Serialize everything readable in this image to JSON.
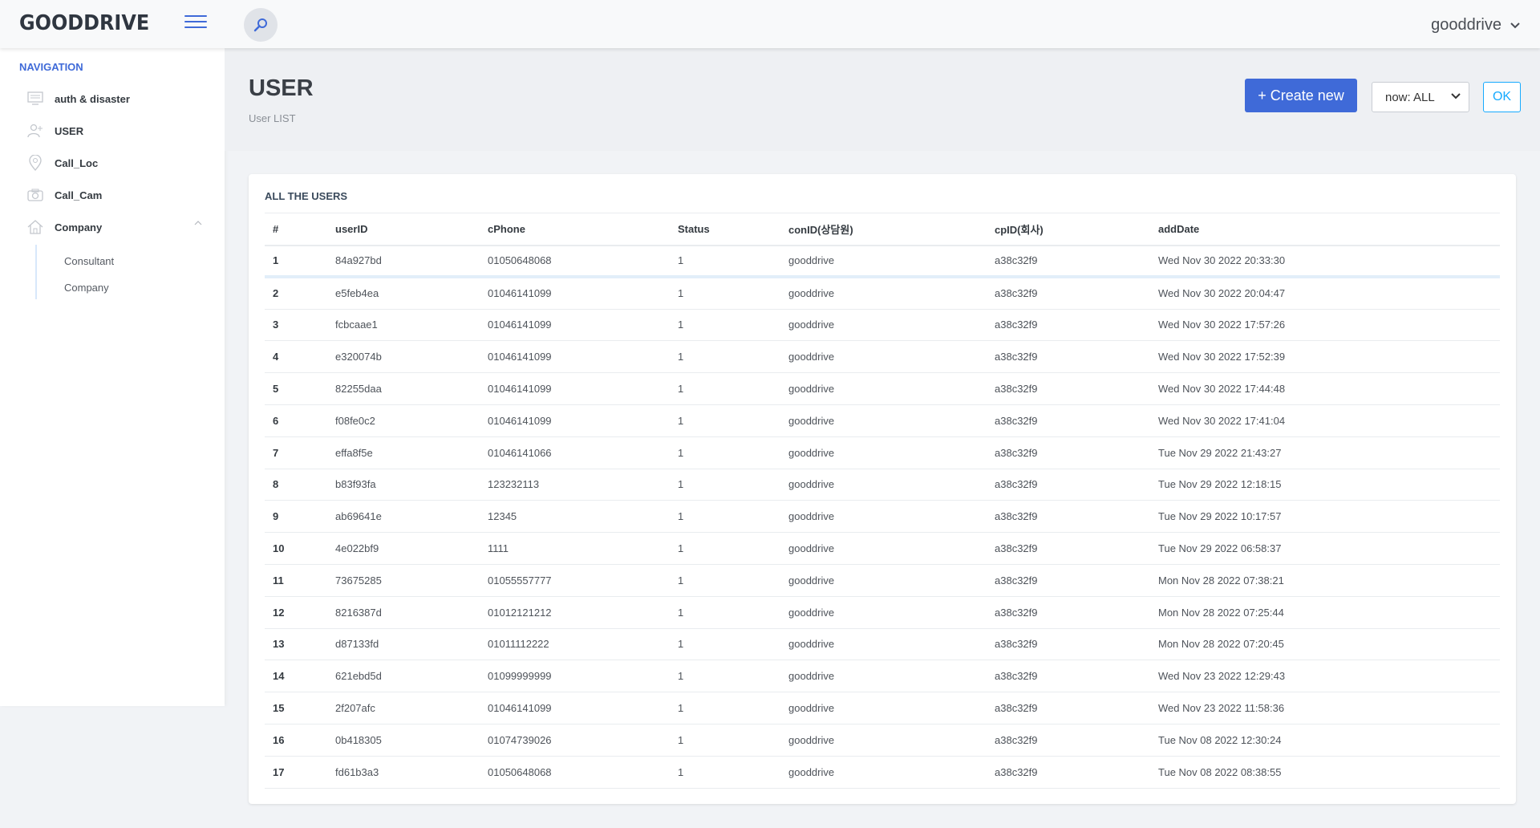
{
  "app": {
    "logo": "GOODDRIVE"
  },
  "header": {
    "user_name": "gooddrive"
  },
  "sidebar": {
    "heading": "NAVIGATION",
    "items": [
      {
        "label": "auth & disaster",
        "icon": "monitor-icon"
      },
      {
        "label": "USER",
        "icon": "user-add-icon"
      },
      {
        "label": "Call_Loc",
        "icon": "map-pin-icon"
      },
      {
        "label": "Call_Cam",
        "icon": "camera-icon"
      },
      {
        "label": "Company",
        "icon": "home-icon"
      }
    ],
    "subitems": [
      {
        "label": "Consultant"
      },
      {
        "label": "Company"
      }
    ]
  },
  "page": {
    "title": "USER",
    "subtitle": "User LIST",
    "create_label": "+ Create new",
    "filter_value": "now: ALL",
    "ok_label": "OK"
  },
  "card": {
    "title": "ALL THE USERS"
  },
  "table": {
    "columns": [
      "#",
      "userID",
      "cPhone",
      "Status",
      "conID(상담원)",
      "cpID(회사)",
      "addDate"
    ],
    "rows": [
      [
        "1",
        "84a927bd",
        "01050648068",
        "1",
        "gooddrive",
        "a38c32f9",
        "Wed Nov 30 2022 20:33:30"
      ],
      [
        "2",
        "e5feb4ea",
        "01046141099",
        "1",
        "gooddrive",
        "a38c32f9",
        "Wed Nov 30 2022 20:04:47"
      ],
      [
        "3",
        "fcbcaae1",
        "01046141099",
        "1",
        "gooddrive",
        "a38c32f9",
        "Wed Nov 30 2022 17:57:26"
      ],
      [
        "4",
        "e320074b",
        "01046141099",
        "1",
        "gooddrive",
        "a38c32f9",
        "Wed Nov 30 2022 17:52:39"
      ],
      [
        "5",
        "82255daa",
        "01046141099",
        "1",
        "gooddrive",
        "a38c32f9",
        "Wed Nov 30 2022 17:44:48"
      ],
      [
        "6",
        "f08fe0c2",
        "01046141099",
        "1",
        "gooddrive",
        "a38c32f9",
        "Wed Nov 30 2022 17:41:04"
      ],
      [
        "7",
        "effa8f5e",
        "01046141066",
        "1",
        "gooddrive",
        "a38c32f9",
        "Tue Nov 29 2022 21:43:27"
      ],
      [
        "8",
        "b83f93fa",
        "123232113",
        "1",
        "gooddrive",
        "a38c32f9",
        "Tue Nov 29 2022 12:18:15"
      ],
      [
        "9",
        "ab69641e",
        "12345",
        "1",
        "gooddrive",
        "a38c32f9",
        "Tue Nov 29 2022 10:17:57"
      ],
      [
        "10",
        "4e022bf9",
        "1111",
        "1",
        "gooddrive",
        "a38c32f9",
        "Tue Nov 29 2022 06:58:37"
      ],
      [
        "11",
        "73675285",
        "01055557777",
        "1",
        "gooddrive",
        "a38c32f9",
        "Mon Nov 28 2022 07:38:21"
      ],
      [
        "12",
        "8216387d",
        "01012121212",
        "1",
        "gooddrive",
        "a38c32f9",
        "Mon Nov 28 2022 07:25:44"
      ],
      [
        "13",
        "d87133fd",
        "01011112222",
        "1",
        "gooddrive",
        "a38c32f9",
        "Mon Nov 28 2022 07:20:45"
      ],
      [
        "14",
        "621ebd5d",
        "01099999999",
        "1",
        "gooddrive",
        "a38c32f9",
        "Wed Nov 23 2022 12:29:43"
      ],
      [
        "15",
        "2f207afc",
        "01046141099",
        "1",
        "gooddrive",
        "a38c32f9",
        "Wed Nov 23 2022 11:58:36"
      ],
      [
        "16",
        "0b418305",
        "01074739026",
        "1",
        "gooddrive",
        "a38c32f9",
        "Tue Nov 08 2022 12:30:24"
      ],
      [
        "17",
        "fd61b3a3",
        "01050648068",
        "1",
        "gooddrive",
        "a38c32f9",
        "Tue Nov 08 2022 08:38:55"
      ]
    ]
  },
  "colors": {
    "accent": "#3f6ad8",
    "info": "#16aaff",
    "page_bg": "#f1f3f6"
  }
}
